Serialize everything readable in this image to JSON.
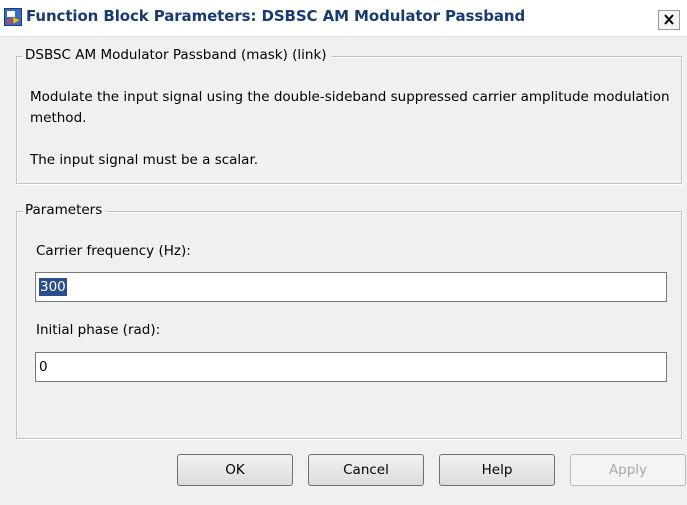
{
  "window": {
    "title": "Function Block Parameters: DSBSC AM Modulator Passband"
  },
  "mask": {
    "heading": "DSBSC AM Modulator Passband (mask) (link)",
    "description": "Modulate the input signal using the double-sideband suppressed carrier amplitude modulation method.",
    "note": "The input signal must be a scalar."
  },
  "parameters": {
    "heading": "Parameters",
    "carrier_label": "Carrier frequency (Hz):",
    "carrier_value": "300",
    "phase_label": "Initial phase (rad):",
    "phase_value": "0"
  },
  "buttons": {
    "ok": "OK",
    "cancel": "Cancel",
    "help": "Help",
    "apply": "Apply"
  },
  "icons": {
    "title_icon": "simulink-block-icon",
    "close_icon": "close-x-icon"
  }
}
